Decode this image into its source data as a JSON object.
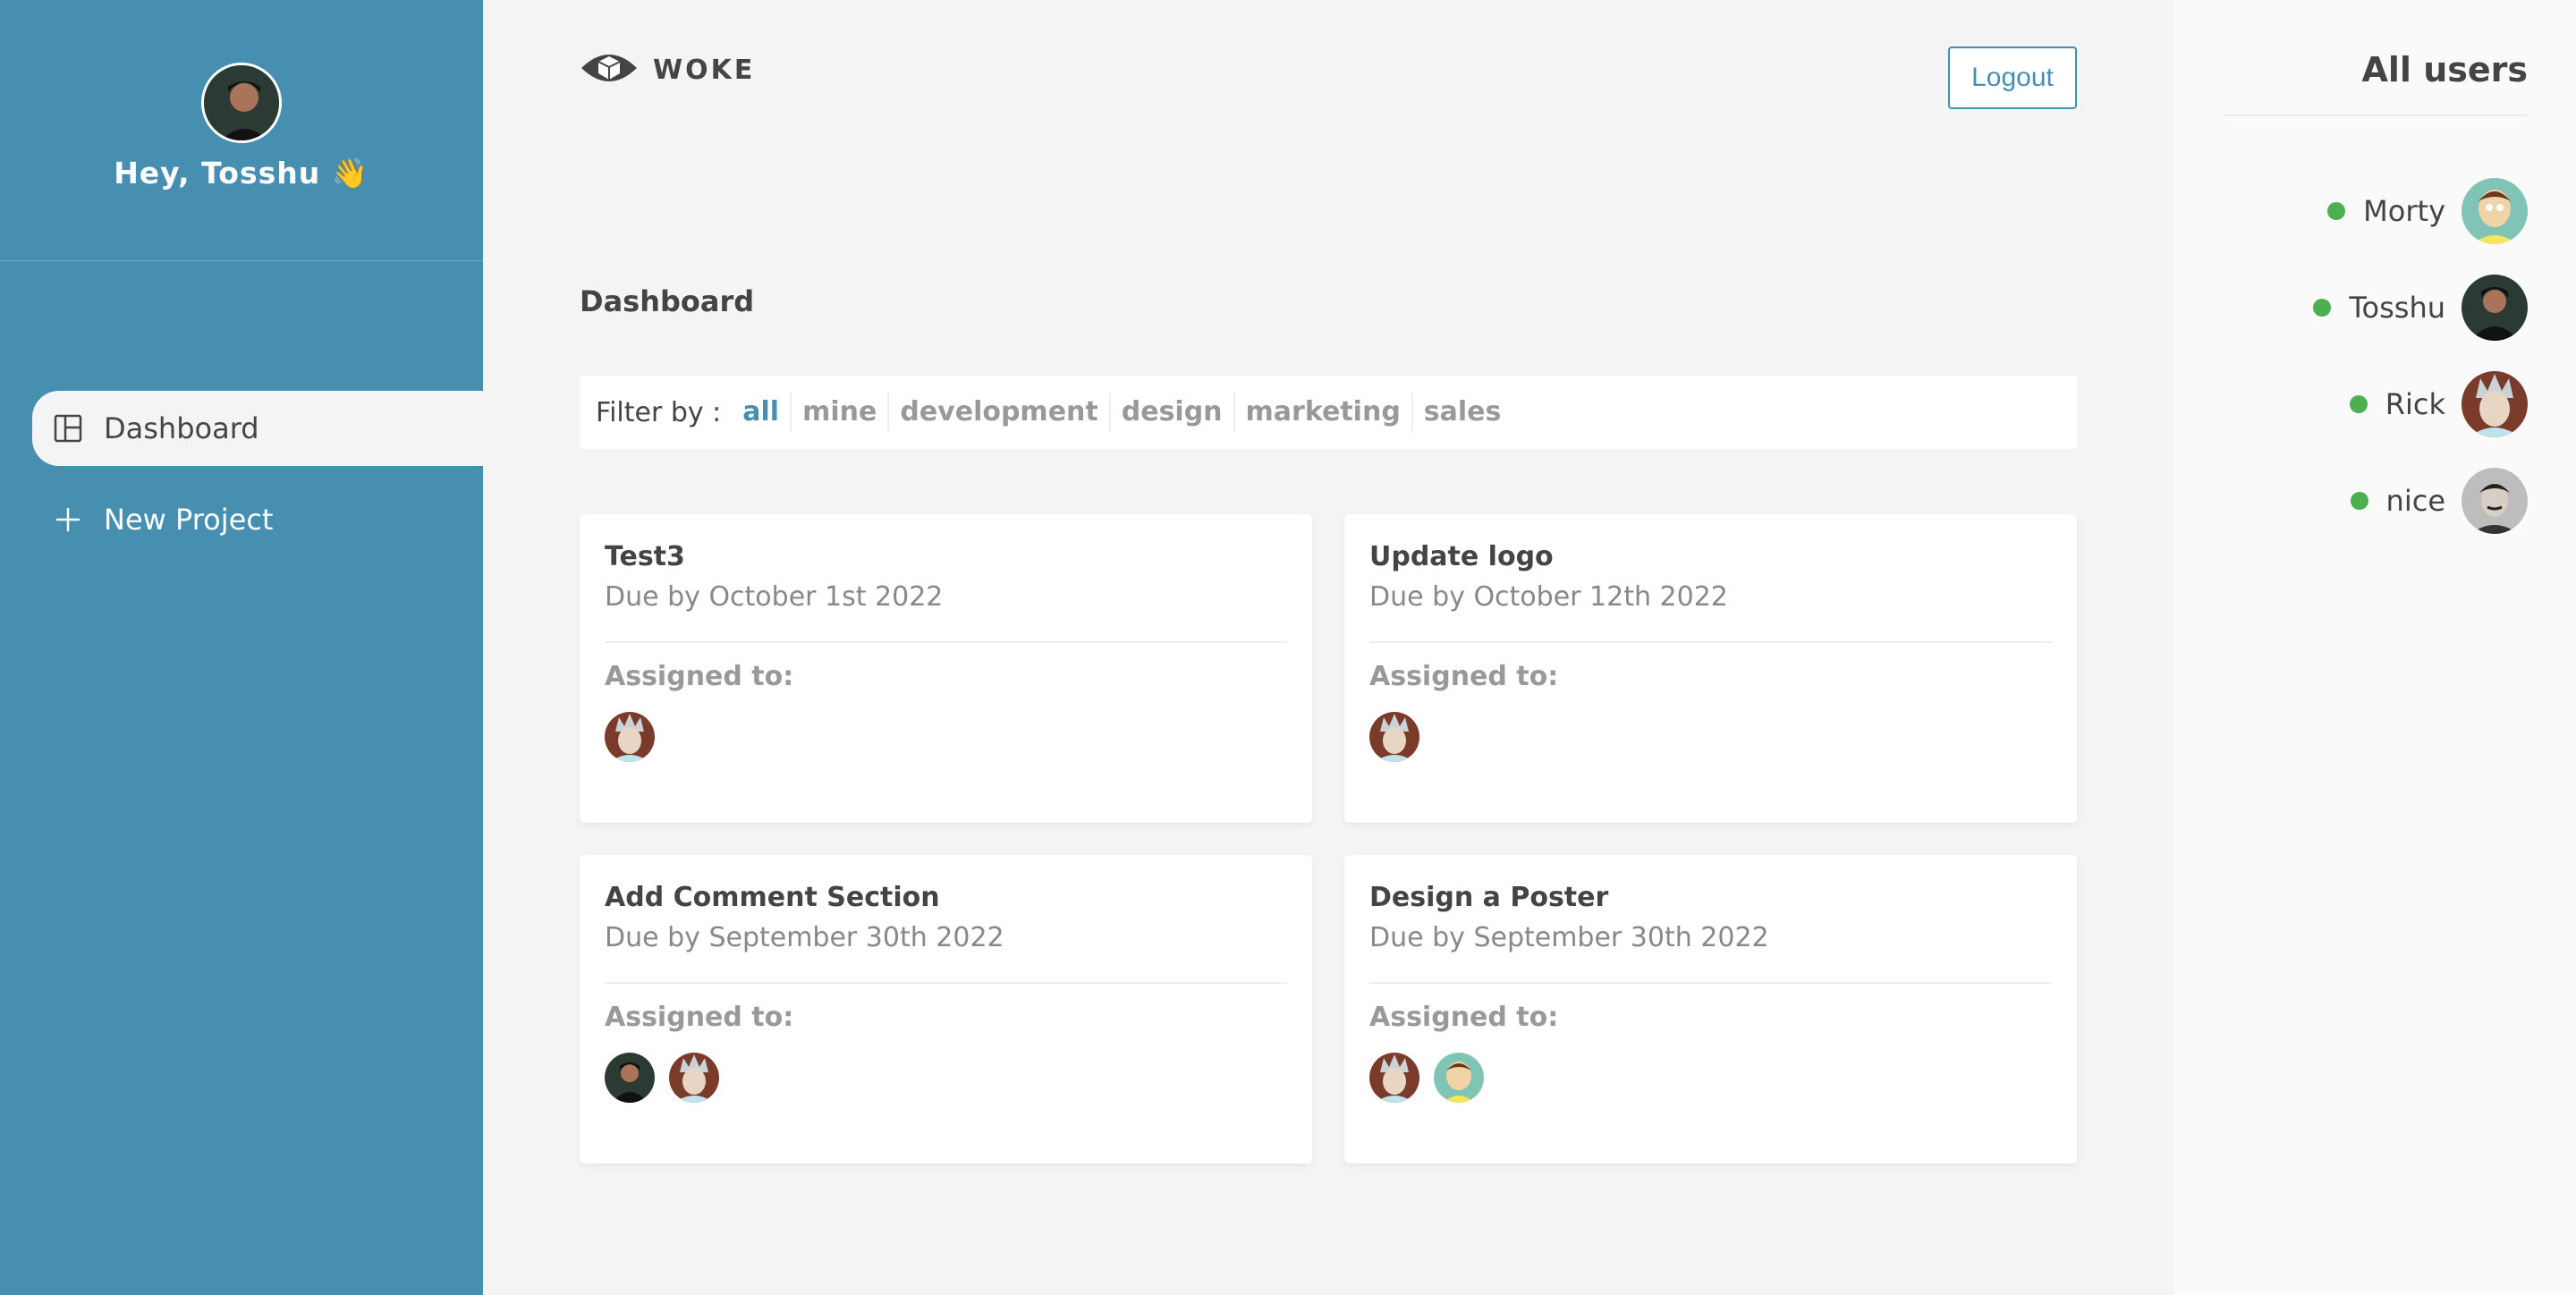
{
  "sidebar": {
    "greeting": "Hey, Tosshu 👋",
    "nav": [
      {
        "label": "Dashboard",
        "icon": "dashboard-icon",
        "active": true
      },
      {
        "label": "New Project",
        "icon": "plus-icon",
        "active": false
      }
    ]
  },
  "header": {
    "logo_text": "WOKE",
    "logout_label": "Logout"
  },
  "main": {
    "title": "Dashboard",
    "filter": {
      "label": "Filter by :",
      "options": [
        "all",
        "mine",
        "development",
        "design",
        "marketing",
        "sales"
      ],
      "selected": "all"
    },
    "projects": [
      {
        "title": "Test3",
        "due": "Due by October 1st 2022",
        "assigned_label": "Assigned to:",
        "assignees": [
          "rick"
        ]
      },
      {
        "title": "Update logo",
        "due": "Due by October 12th 2022",
        "assigned_label": "Assigned to:",
        "assignees": [
          "rick"
        ]
      },
      {
        "title": "Add Comment Section",
        "due": "Due by September 30th 2022",
        "assigned_label": "Assigned to:",
        "assignees": [
          "tosshu",
          "rick"
        ]
      },
      {
        "title": "Design a Poster",
        "due": "Due by September 30th 2022",
        "assigned_label": "Assigned to:",
        "assignees": [
          "rick",
          "morty"
        ]
      }
    ]
  },
  "users_panel": {
    "title": "All users",
    "users": [
      {
        "name": "Morty",
        "online": true,
        "avatar": "morty"
      },
      {
        "name": "Tosshu",
        "online": true,
        "avatar": "tosshu"
      },
      {
        "name": "Rick",
        "online": true,
        "avatar": "rick"
      },
      {
        "name": "nice",
        "online": true,
        "avatar": "tesla"
      }
    ]
  },
  "colors": {
    "sidebar_bg": "#468fb0",
    "accent": "#468fb0",
    "online": "#4caf50",
    "main_bg": "#f4f4f4"
  }
}
